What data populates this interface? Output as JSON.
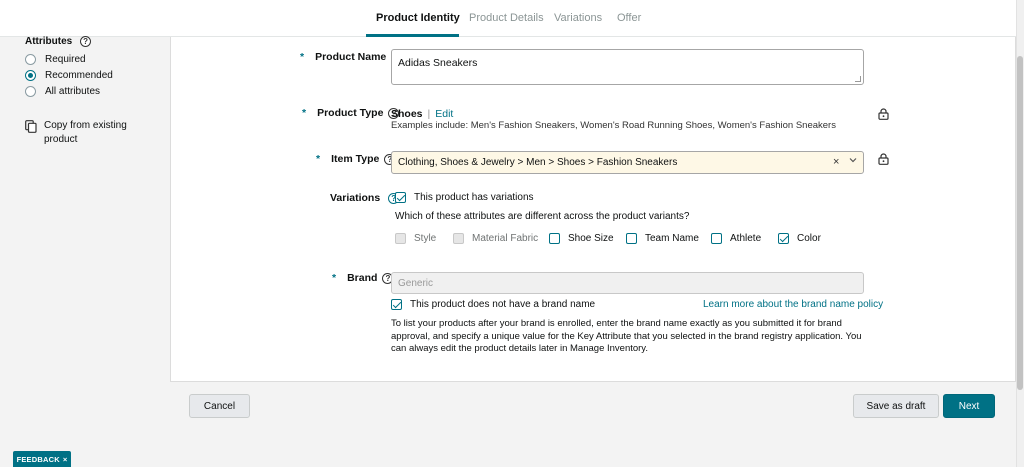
{
  "tabs": [
    {
      "label": "Product Identity",
      "active": true
    },
    {
      "label": "Product Details",
      "active": false
    },
    {
      "label": "Variations",
      "active": false
    },
    {
      "label": "Offer",
      "active": false
    }
  ],
  "sidebar": {
    "title": "Attributes",
    "help_icon": "?",
    "options": [
      {
        "label": "Required",
        "selected": false
      },
      {
        "label": "Recommended",
        "selected": true
      },
      {
        "label": "All attributes",
        "selected": false
      }
    ],
    "copy_label": "Copy from existing product"
  },
  "form": {
    "required_marker": "*",
    "help_icon": "?",
    "product_name": {
      "label": "Product Name",
      "value": "Adidas Sneakers"
    },
    "product_type": {
      "label": "Product Type",
      "value": "Shoes",
      "separator": "|",
      "edit_label": "Edit",
      "examples": "Examples include: Men's Fashion Sneakers, Women's Road Running Shoes, Women's Fashion Sneakers"
    },
    "item_type": {
      "label": "Item Type",
      "value": "Clothing, Shoes & Jewelry > Men > Shoes > Fashion Sneakers",
      "clear_icon": "×"
    },
    "variations": {
      "label": "Variations",
      "has_variations_label": "This product has variations",
      "has_variations_checked": true,
      "question": "Which of these attributes are different across the product variants?",
      "attributes": [
        {
          "label": "Style",
          "checked": false,
          "disabled": true
        },
        {
          "label": "Material Fabric",
          "checked": false,
          "disabled": true
        },
        {
          "label": "Shoe Size",
          "checked": false,
          "disabled": false
        },
        {
          "label": "Team Name",
          "checked": false,
          "disabled": false
        },
        {
          "label": "Athlete",
          "checked": false,
          "disabled": false
        },
        {
          "label": "Color",
          "checked": true,
          "disabled": false
        }
      ]
    },
    "brand": {
      "label": "Brand",
      "placeholder": "Generic",
      "no_brand_label": "This product does not have a brand name",
      "no_brand_checked": true,
      "policy_link": "Learn more about the brand name policy",
      "info": "To list your products after your brand is enrolled, enter the brand name exactly as you submitted it for brand approval, and specify a unique value for the Key Attribute that you selected in the brand registry application. You can always edit the product details later in Manage Inventory."
    }
  },
  "footer": {
    "cancel_label": "Cancel",
    "draft_label": "Save as draft",
    "next_label": "Next"
  },
  "feedback": {
    "label": "FEEDBACK",
    "close_icon": "×"
  },
  "colors": {
    "accent": "#007185",
    "item_type_bg": "#fef8e6"
  }
}
